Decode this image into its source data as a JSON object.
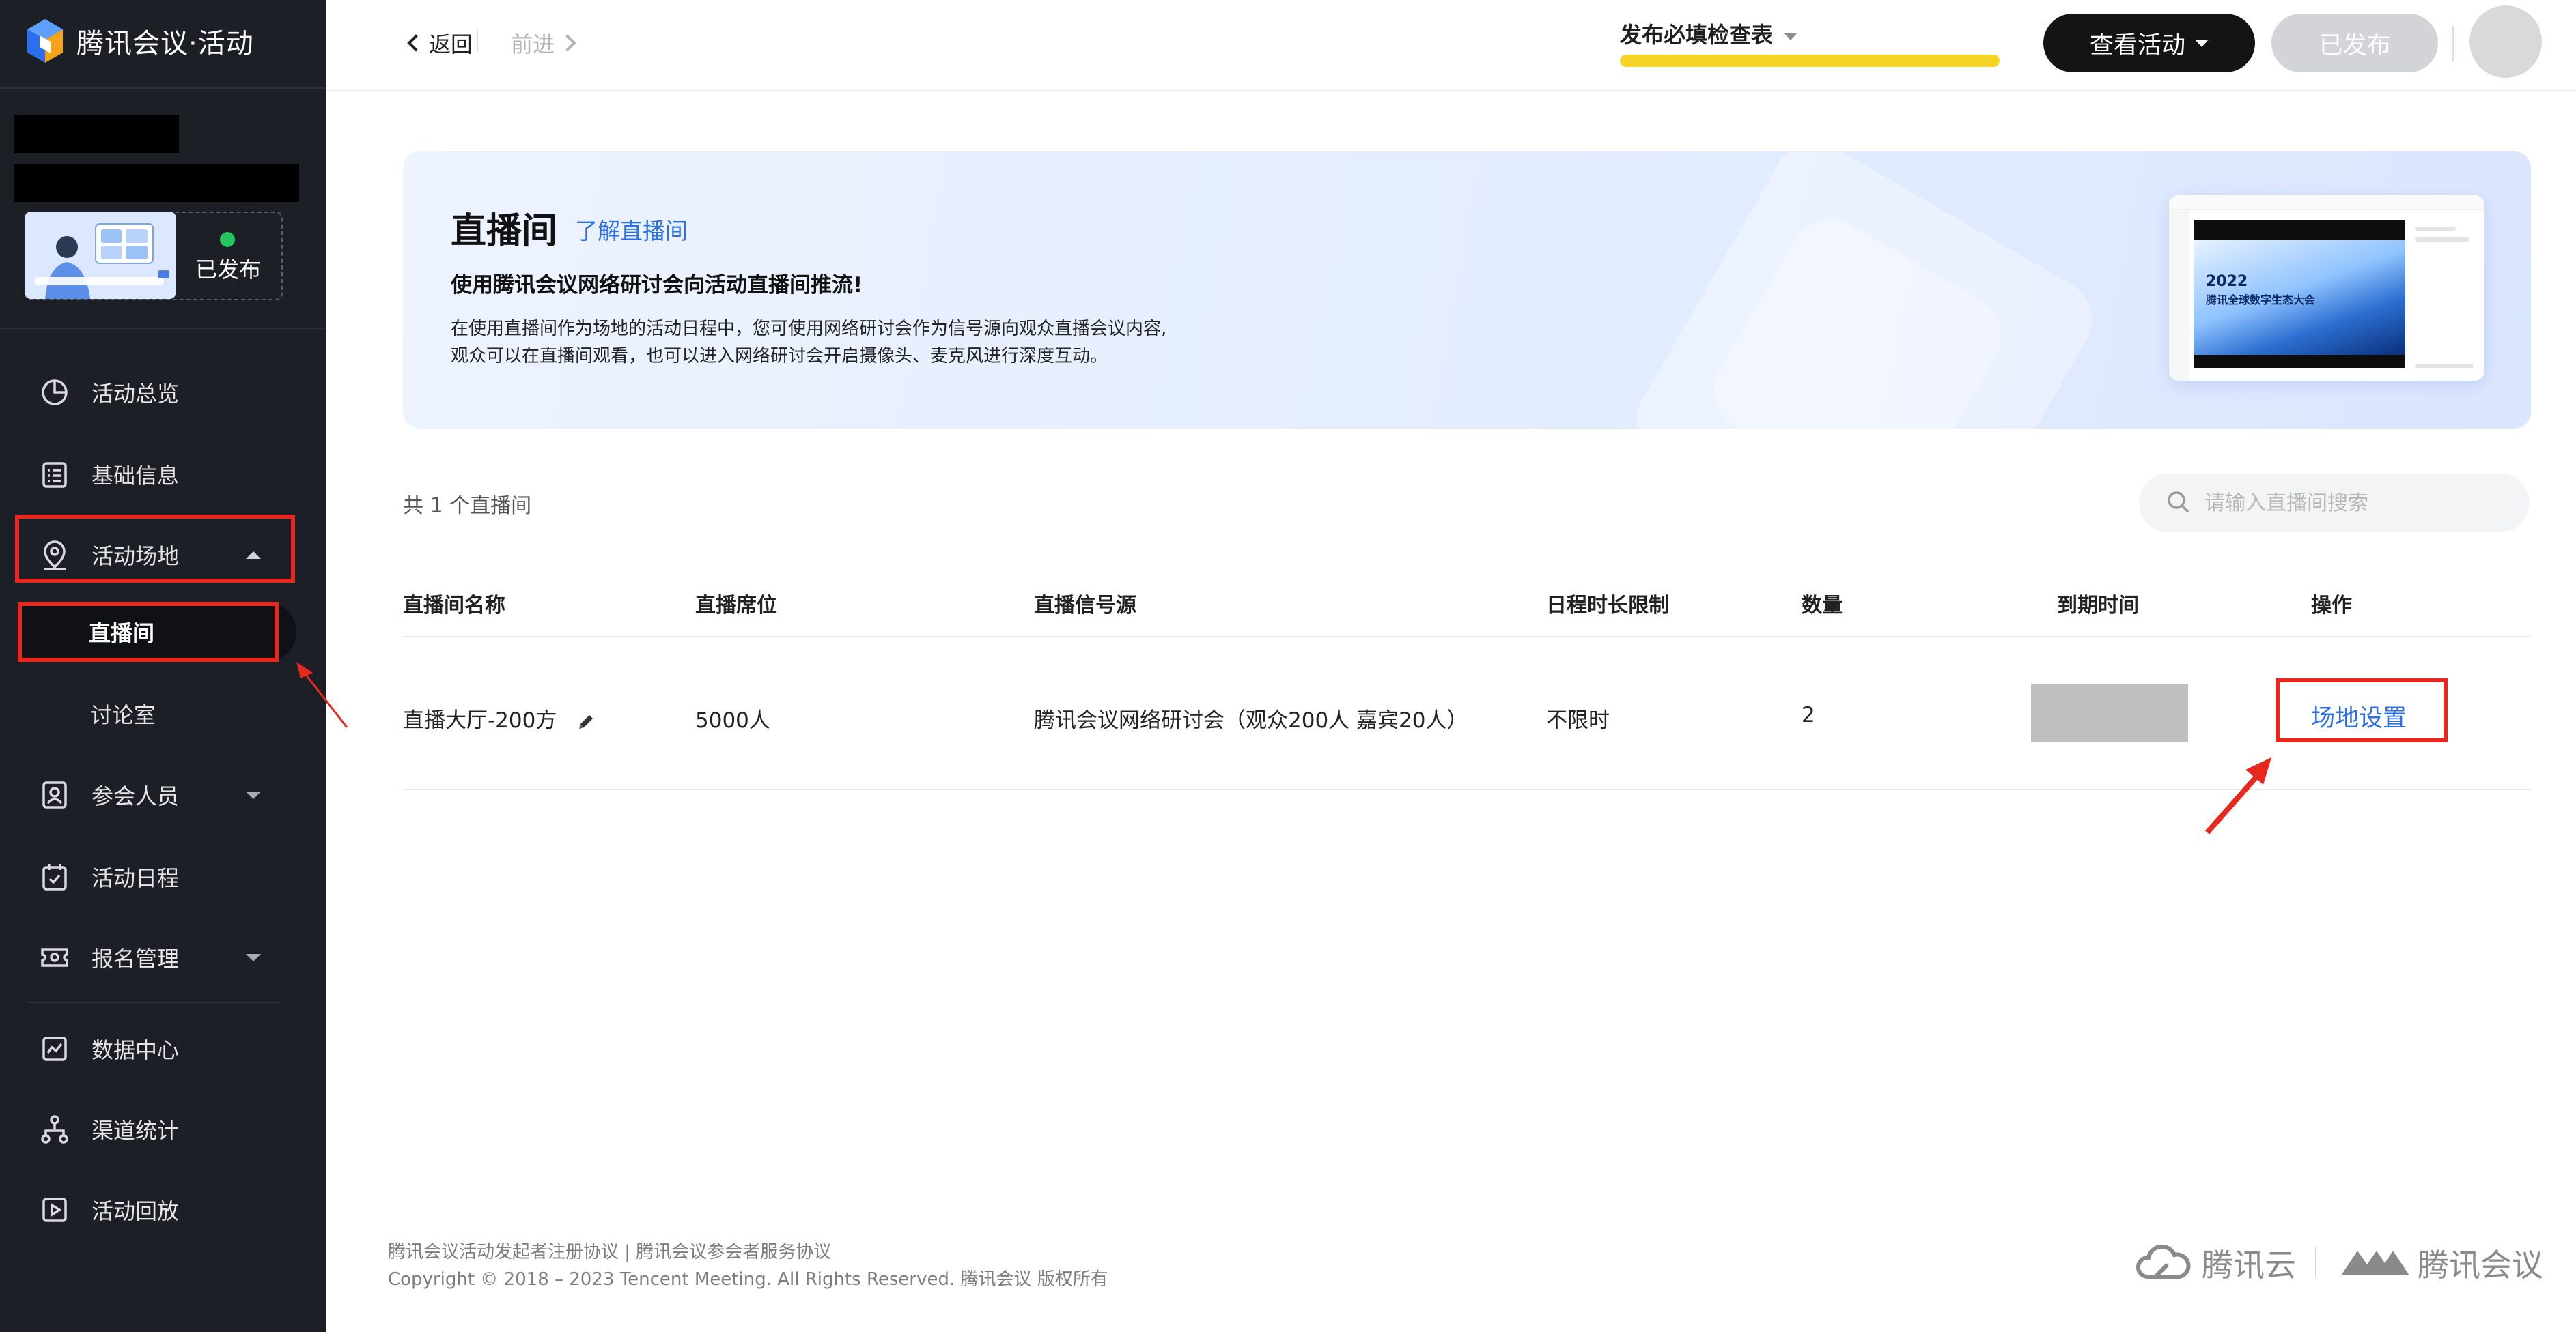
{
  "app": {
    "brand": "腾讯会议·活动",
    "status_text": "已发布"
  },
  "sidebar": {
    "items": [
      {
        "label": "活动总览"
      },
      {
        "label": "基础信息"
      },
      {
        "label": "活动场地"
      },
      {
        "label": "参会人员"
      },
      {
        "label": "活动日程"
      },
      {
        "label": "报名管理"
      },
      {
        "label": "数据中心"
      },
      {
        "label": "渠道统计"
      },
      {
        "label": "活动回放"
      }
    ],
    "sub_items": [
      {
        "label": "直播间",
        "active": true
      },
      {
        "label": "讨论室"
      }
    ]
  },
  "topbar": {
    "back_label": "返回",
    "forward_label": "前进",
    "checklist_label": "发布必填检查表",
    "checklist_progress": 1.0,
    "view_button": "查看活动",
    "publish_button": "已发布"
  },
  "banner": {
    "title": "直播间",
    "link": "了解直播间",
    "subtitle": "使用腾讯会议网络研讨会向活动直播间推流!",
    "desc_line1": "在使用直播间作为场地的活动日程中，您可使用网络研讨会作为信号源向观众直播会议内容,",
    "desc_line2": "观众可以在直播间观看，也可以进入网络研讨会开启摄像头、麦克风进行深度互动。",
    "preview_title": "2022",
    "preview_subtitle": "腾讯全球数字生态大会"
  },
  "list": {
    "count_text": "共 1 个直播间",
    "search_placeholder": "请输入直播间搜索",
    "columns": [
      "直播间名称",
      "直播席位",
      "直播信号源",
      "日程时长限制",
      "数量",
      "到期时间",
      "操作"
    ],
    "rows": [
      {
        "name": "直播大厅-200方",
        "seats": "5000人",
        "source": "腾讯会议网络研讨会（观众200人 嘉宾20人）",
        "limit": "不限时",
        "quantity": "2",
        "action": "场地设置"
      }
    ]
  },
  "footer": {
    "links": "腾讯会议活动发起者注册协议 | 腾讯会议参会者服务协议",
    "copyright": "Copyright © 2018 – 2023 Tencent Meeting. All Rights Reserved. 腾讯会议 版权所有",
    "brand_cloud": "腾讯云",
    "brand_meeting": "腾讯会议"
  },
  "colors": {
    "accent": "#2a6ee8",
    "highlight": "#e8281e",
    "sidebar_bg": "#1c1f26",
    "progress": "#f5d327"
  }
}
